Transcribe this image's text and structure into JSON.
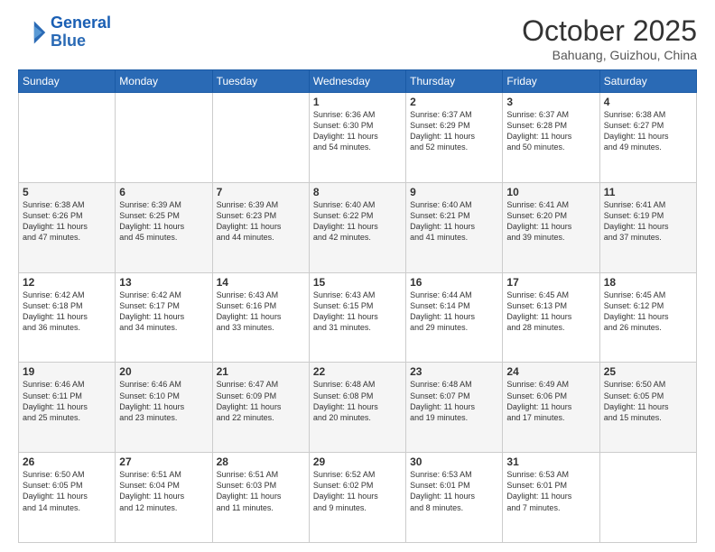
{
  "header": {
    "logo_line1": "General",
    "logo_line2": "Blue",
    "month_title": "October 2025",
    "location": "Bahuang, Guizhou, China"
  },
  "weekdays": [
    "Sunday",
    "Monday",
    "Tuesday",
    "Wednesday",
    "Thursday",
    "Friday",
    "Saturday"
  ],
  "weeks": [
    [
      {
        "day": "",
        "info": ""
      },
      {
        "day": "",
        "info": ""
      },
      {
        "day": "",
        "info": ""
      },
      {
        "day": "1",
        "info": "Sunrise: 6:36 AM\nSunset: 6:30 PM\nDaylight: 11 hours\nand 54 minutes."
      },
      {
        "day": "2",
        "info": "Sunrise: 6:37 AM\nSunset: 6:29 PM\nDaylight: 11 hours\nand 52 minutes."
      },
      {
        "day": "3",
        "info": "Sunrise: 6:37 AM\nSunset: 6:28 PM\nDaylight: 11 hours\nand 50 minutes."
      },
      {
        "day": "4",
        "info": "Sunrise: 6:38 AM\nSunset: 6:27 PM\nDaylight: 11 hours\nand 49 minutes."
      }
    ],
    [
      {
        "day": "5",
        "info": "Sunrise: 6:38 AM\nSunset: 6:26 PM\nDaylight: 11 hours\nand 47 minutes."
      },
      {
        "day": "6",
        "info": "Sunrise: 6:39 AM\nSunset: 6:25 PM\nDaylight: 11 hours\nand 45 minutes."
      },
      {
        "day": "7",
        "info": "Sunrise: 6:39 AM\nSunset: 6:23 PM\nDaylight: 11 hours\nand 44 minutes."
      },
      {
        "day": "8",
        "info": "Sunrise: 6:40 AM\nSunset: 6:22 PM\nDaylight: 11 hours\nand 42 minutes."
      },
      {
        "day": "9",
        "info": "Sunrise: 6:40 AM\nSunset: 6:21 PM\nDaylight: 11 hours\nand 41 minutes."
      },
      {
        "day": "10",
        "info": "Sunrise: 6:41 AM\nSunset: 6:20 PM\nDaylight: 11 hours\nand 39 minutes."
      },
      {
        "day": "11",
        "info": "Sunrise: 6:41 AM\nSunset: 6:19 PM\nDaylight: 11 hours\nand 37 minutes."
      }
    ],
    [
      {
        "day": "12",
        "info": "Sunrise: 6:42 AM\nSunset: 6:18 PM\nDaylight: 11 hours\nand 36 minutes."
      },
      {
        "day": "13",
        "info": "Sunrise: 6:42 AM\nSunset: 6:17 PM\nDaylight: 11 hours\nand 34 minutes."
      },
      {
        "day": "14",
        "info": "Sunrise: 6:43 AM\nSunset: 6:16 PM\nDaylight: 11 hours\nand 33 minutes."
      },
      {
        "day": "15",
        "info": "Sunrise: 6:43 AM\nSunset: 6:15 PM\nDaylight: 11 hours\nand 31 minutes."
      },
      {
        "day": "16",
        "info": "Sunrise: 6:44 AM\nSunset: 6:14 PM\nDaylight: 11 hours\nand 29 minutes."
      },
      {
        "day": "17",
        "info": "Sunrise: 6:45 AM\nSunset: 6:13 PM\nDaylight: 11 hours\nand 28 minutes."
      },
      {
        "day": "18",
        "info": "Sunrise: 6:45 AM\nSunset: 6:12 PM\nDaylight: 11 hours\nand 26 minutes."
      }
    ],
    [
      {
        "day": "19",
        "info": "Sunrise: 6:46 AM\nSunset: 6:11 PM\nDaylight: 11 hours\nand 25 minutes."
      },
      {
        "day": "20",
        "info": "Sunrise: 6:46 AM\nSunset: 6:10 PM\nDaylight: 11 hours\nand 23 minutes."
      },
      {
        "day": "21",
        "info": "Sunrise: 6:47 AM\nSunset: 6:09 PM\nDaylight: 11 hours\nand 22 minutes."
      },
      {
        "day": "22",
        "info": "Sunrise: 6:48 AM\nSunset: 6:08 PM\nDaylight: 11 hours\nand 20 minutes."
      },
      {
        "day": "23",
        "info": "Sunrise: 6:48 AM\nSunset: 6:07 PM\nDaylight: 11 hours\nand 19 minutes."
      },
      {
        "day": "24",
        "info": "Sunrise: 6:49 AM\nSunset: 6:06 PM\nDaylight: 11 hours\nand 17 minutes."
      },
      {
        "day": "25",
        "info": "Sunrise: 6:50 AM\nSunset: 6:05 PM\nDaylight: 11 hours\nand 15 minutes."
      }
    ],
    [
      {
        "day": "26",
        "info": "Sunrise: 6:50 AM\nSunset: 6:05 PM\nDaylight: 11 hours\nand 14 minutes."
      },
      {
        "day": "27",
        "info": "Sunrise: 6:51 AM\nSunset: 6:04 PM\nDaylight: 11 hours\nand 12 minutes."
      },
      {
        "day": "28",
        "info": "Sunrise: 6:51 AM\nSunset: 6:03 PM\nDaylight: 11 hours\nand 11 minutes."
      },
      {
        "day": "29",
        "info": "Sunrise: 6:52 AM\nSunset: 6:02 PM\nDaylight: 11 hours\nand 9 minutes."
      },
      {
        "day": "30",
        "info": "Sunrise: 6:53 AM\nSunset: 6:01 PM\nDaylight: 11 hours\nand 8 minutes."
      },
      {
        "day": "31",
        "info": "Sunrise: 6:53 AM\nSunset: 6:01 PM\nDaylight: 11 hours\nand 7 minutes."
      },
      {
        "day": "",
        "info": ""
      }
    ]
  ]
}
